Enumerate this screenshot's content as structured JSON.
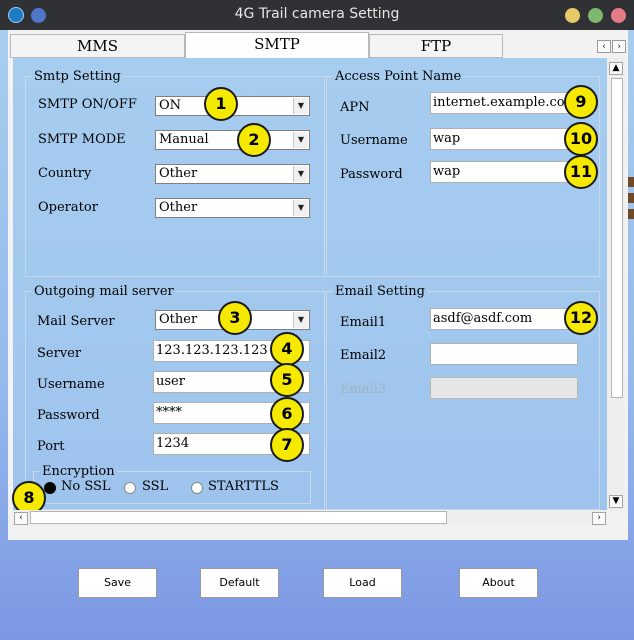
{
  "window": {
    "title": "4G Trail camera Setting",
    "controls": {
      "minimize_color": "#e8c96a",
      "maximize_color": "#7fb86d",
      "close_color": "#e47b86"
    }
  },
  "tabs": [
    {
      "label": "MMS",
      "active": false
    },
    {
      "label": "SMTP",
      "active": true
    },
    {
      "label": "FTP",
      "active": false
    }
  ],
  "smtp_setting": {
    "legend": "Smtp Setting",
    "on_off": {
      "label": "SMTP ON/OFF",
      "value": "ON"
    },
    "mode": {
      "label": "SMTP MODE",
      "value": "Manual"
    },
    "country": {
      "label": "Country",
      "value": "Other"
    },
    "operator": {
      "label": "Operator",
      "value": "Other"
    }
  },
  "access_point": {
    "legend": "Access Point Name",
    "apn": {
      "label": "APN",
      "value": "internet.example.com"
    },
    "username": {
      "label": "Username",
      "value": "wap"
    },
    "password": {
      "label": "Password",
      "value": "wap"
    }
  },
  "outgoing": {
    "legend": "Outgoing mail server",
    "mail_server": {
      "label": "Mail Server",
      "value": "Other"
    },
    "server": {
      "label": "Server",
      "value": "123.123.123.123"
    },
    "username": {
      "label": "Username",
      "value": "user"
    },
    "password": {
      "label": "Password",
      "value": "****"
    },
    "port": {
      "label": "Port",
      "value": "1234"
    },
    "encryption": {
      "legend": "Encryption",
      "options": [
        {
          "label": "No SSL",
          "selected": true
        },
        {
          "label": "SSL",
          "selected": false
        },
        {
          "label": "STARTTLS",
          "selected": false
        }
      ]
    }
  },
  "email_setting": {
    "legend": "Email Setting",
    "email1": {
      "label": "Email1",
      "value": "asdf@asdf.com"
    },
    "email2": {
      "label": "Email2",
      "value": ""
    },
    "email3": {
      "label": "Email3",
      "value": "",
      "disabled": true
    }
  },
  "badges": [
    "1",
    "2",
    "3",
    "4",
    "5",
    "6",
    "7",
    "8",
    "9",
    "10",
    "11",
    "12"
  ],
  "buttons": {
    "save": "Save",
    "default": "Default",
    "load": "Load",
    "about": "About"
  },
  "icons": {
    "left_arrow": "‹",
    "right_arrow": "›",
    "down_arrow": "▼",
    "up_arrow": "▲",
    "dropdown": "▼"
  }
}
